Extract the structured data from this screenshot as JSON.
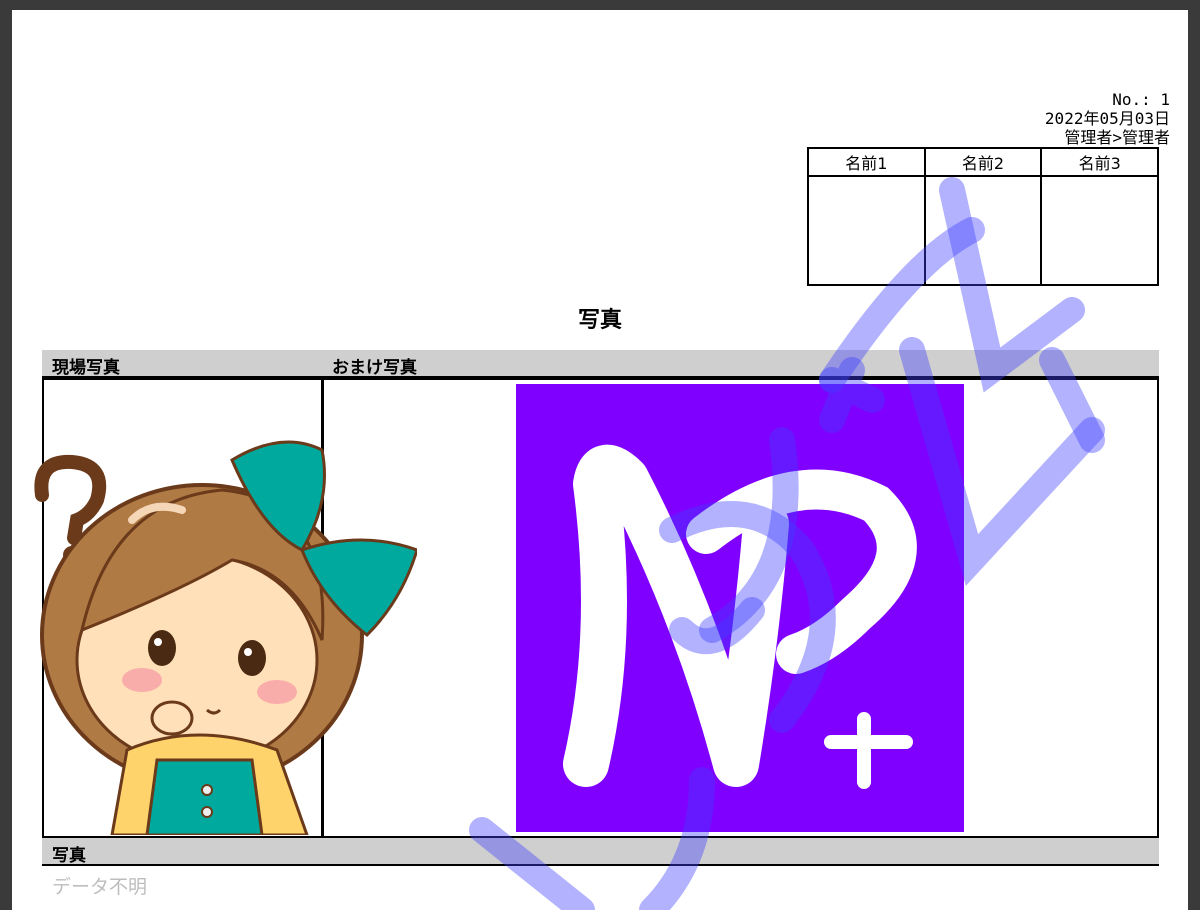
{
  "header": {
    "number": "No.: 1",
    "date": "2022年05月03日",
    "author": "管理者>管理者"
  },
  "approval_table": {
    "columns": [
      "名前1",
      "名前2",
      "名前3"
    ]
  },
  "title": "写真",
  "photo_section": {
    "left_label": "現場写真",
    "right_label": "おまけ写真"
  },
  "bottom_section": {
    "label": "写真",
    "empty_text": "データ不明"
  },
  "colors": {
    "logo_bg": "#8000ff",
    "watermark": "#3f3fff",
    "ribbon": "#00a99d",
    "hair": "#b07a45"
  },
  "icons": {
    "character": "confused-girl-illustration",
    "logo": "np-plus-logo"
  }
}
